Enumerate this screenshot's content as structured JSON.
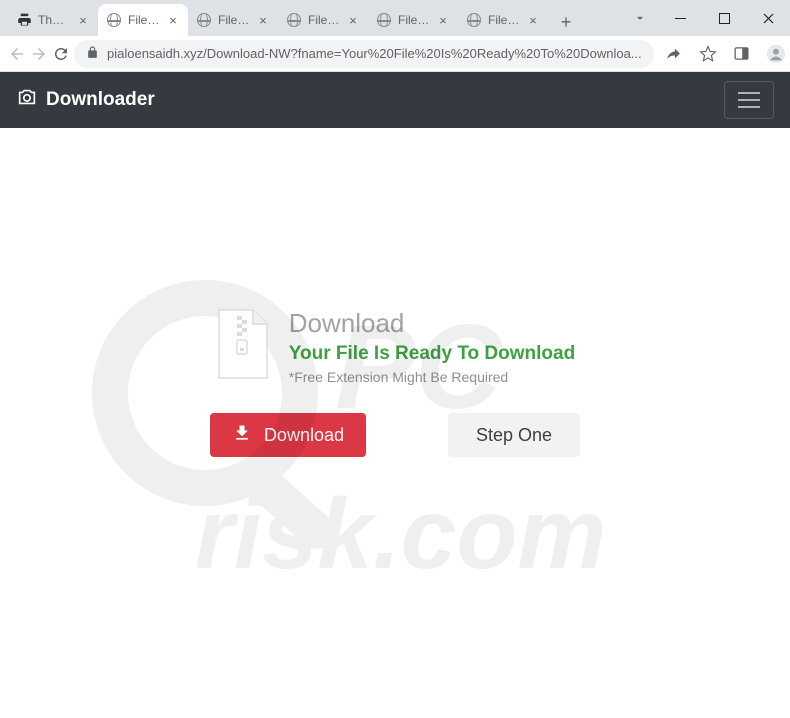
{
  "window": {
    "tabs": [
      {
        "title": "The Pir",
        "active": false,
        "favicon": "printer"
      },
      {
        "title": "File Do",
        "active": true,
        "favicon": "globe"
      },
      {
        "title": "File Do",
        "active": false,
        "favicon": "globe"
      },
      {
        "title": "File Do",
        "active": false,
        "favicon": "globe"
      },
      {
        "title": "File Do",
        "active": false,
        "favicon": "globe"
      },
      {
        "title": "File Do",
        "active": false,
        "favicon": "globe"
      }
    ]
  },
  "addressbar": {
    "url": "pialoensaidh.xyz/Download-NW?fname=Your%20File%20Is%20Ready%20To%20Downloa..."
  },
  "page": {
    "brand": "Downloader",
    "download": {
      "heading": "Download",
      "subheading": "Your File Is Ready To Download",
      "note": "*Free Extension Might Be Required"
    },
    "buttons": {
      "download": "Download",
      "step": "Step One"
    }
  },
  "watermark": "PCrisk.com"
}
